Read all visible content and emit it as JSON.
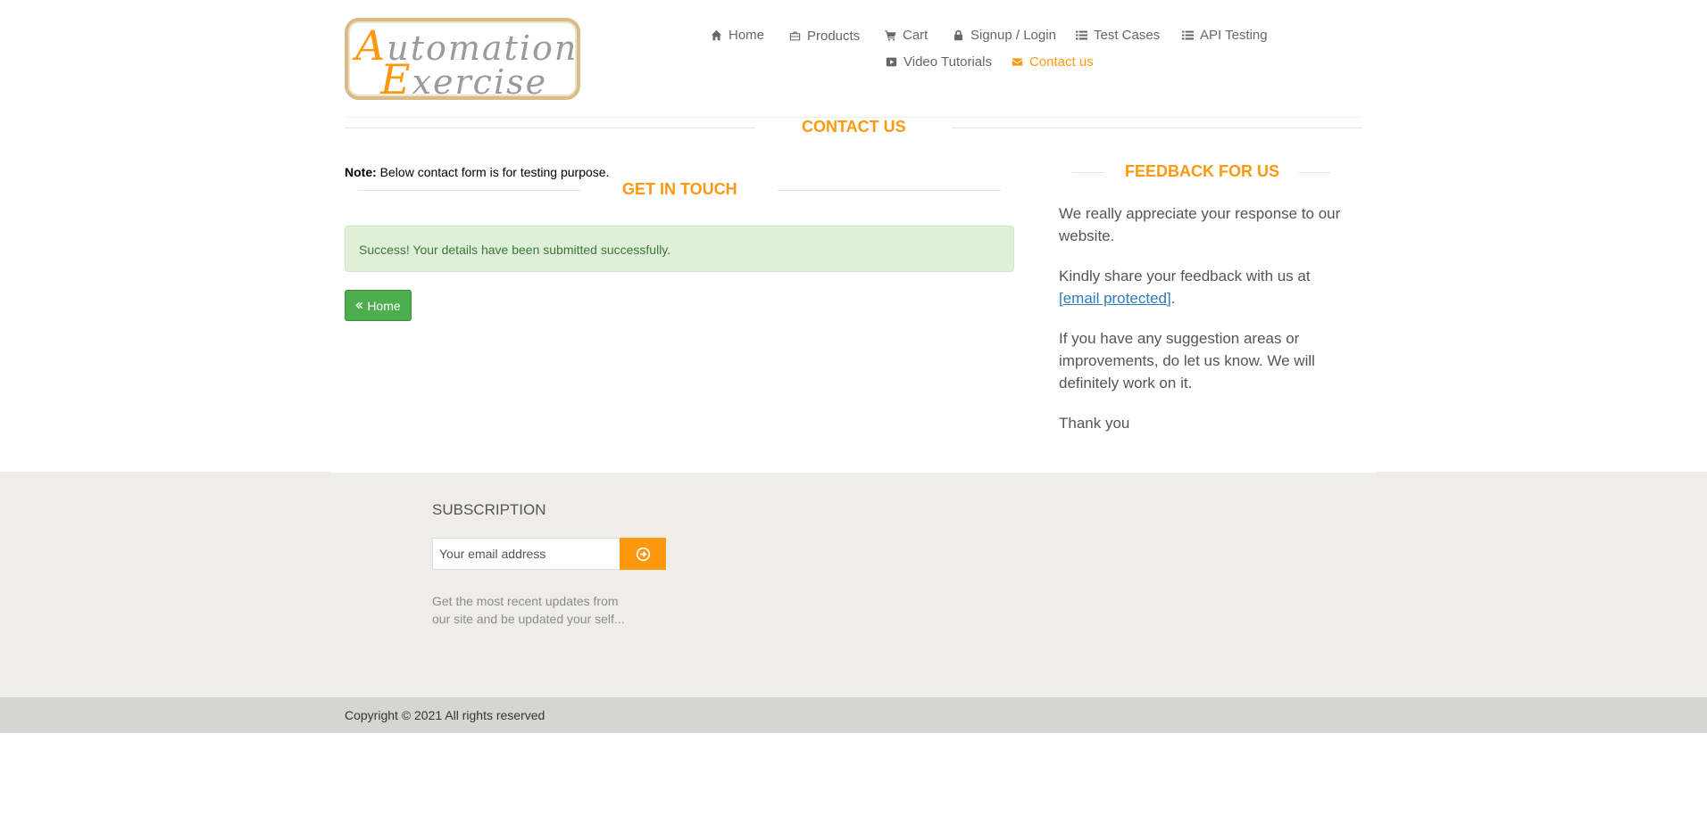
{
  "header": {
    "logo": {
      "line1_cap": "A",
      "line1_rest": "utomation",
      "line2_cap": "E",
      "line2_rest": "xercise"
    },
    "nav": [
      {
        "label": "Home",
        "icon": "home-icon"
      },
      {
        "label": "Products",
        "icon": "briefcase-icon"
      },
      {
        "label": "Cart",
        "icon": "cart-icon"
      },
      {
        "label": "Signup / Login",
        "icon": "lock-icon"
      },
      {
        "label": "Test Cases",
        "icon": "list-icon"
      },
      {
        "label": "API Testing",
        "icon": "list-icon"
      },
      {
        "label": "Video Tutorials",
        "icon": "youtube-play-icon"
      },
      {
        "label": "Contact us",
        "icon": "envelope-icon",
        "active": true
      }
    ]
  },
  "main": {
    "page_title": "Contact Us",
    "note_label": "Note:",
    "note_text": " Below contact form is for testing purpose.",
    "get_in_touch": "Get In Touch",
    "alert": "Success! Your details have been submitted successfully.",
    "home_button": "Home"
  },
  "feedback": {
    "title": "Feedback For Us",
    "p1": "We really appreciate your response to our website.",
    "p2_text": "Kindly share your feedback with us at ",
    "p2_link": "[email protected]",
    "p2_end": ".",
    "p3": "If you have any suggestion areas or improvements, do let us know. We will definitely work on it.",
    "p4": "Thank you"
  },
  "footer": {
    "subscription_title": "Subscription",
    "email_placeholder": "Your email address",
    "description": "Get the most recent updates from our site and be updated your self...",
    "copyright": "Copyright © 2021 All rights reserved"
  },
  "colors": {
    "accent": "#fe980f",
    "success_bg": "#dff0d8",
    "success_text": "#3c763d",
    "button_green": "#4cae4c",
    "footer_bg": "#eeede7",
    "footer_bottom_bg": "#d6d6d0"
  }
}
